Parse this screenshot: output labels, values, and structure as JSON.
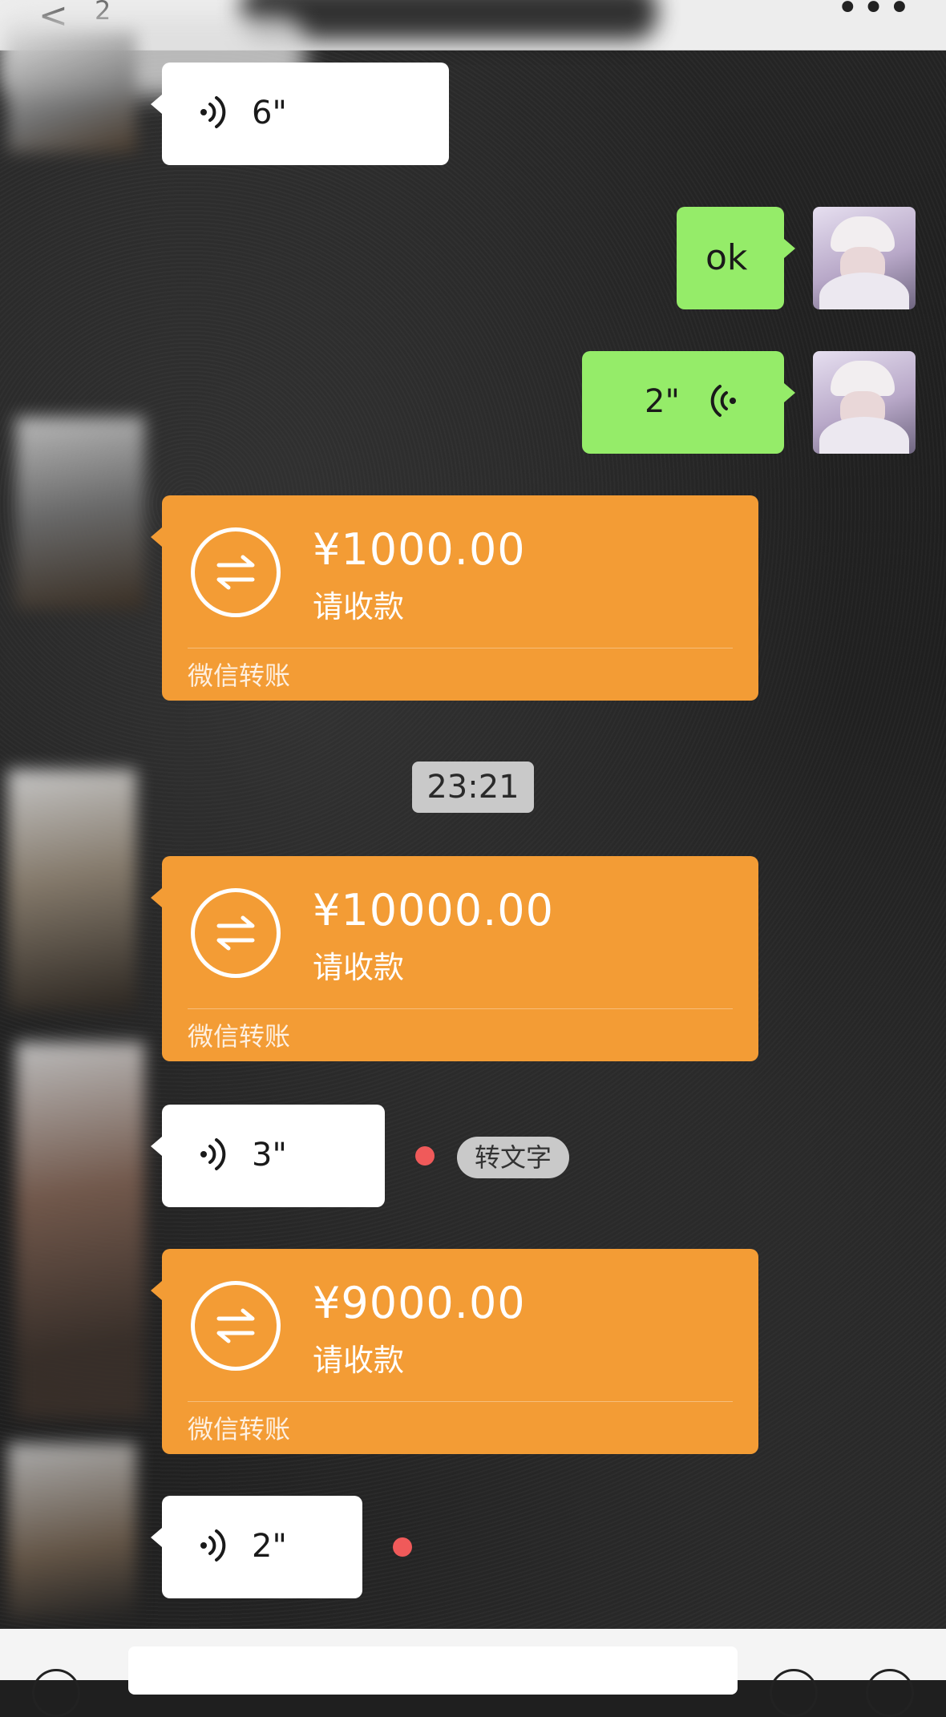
{
  "top_bar": {
    "back_glyph": "<",
    "unread_count": "2",
    "more_glyph": "•••"
  },
  "messages": {
    "voice_1": {
      "duration": "6\"",
      "unread": false
    },
    "text_ok": {
      "text": "ok"
    },
    "voice_sent": {
      "duration": "2\""
    },
    "transfer_1": {
      "amount": "¥1000.00",
      "status": "请收款",
      "footer": "微信转账"
    },
    "timestamp": "23:21",
    "transfer_2": {
      "amount": "¥10000.00",
      "status": "请收款",
      "footer": "微信转账"
    },
    "voice_2": {
      "duration": "3\"",
      "unread": true,
      "to_text_label": "转文字"
    },
    "transfer_3": {
      "amount": "¥9000.00",
      "status": "请收款",
      "footer": "微信转账"
    },
    "voice_3": {
      "duration": "2\"",
      "unread": true
    }
  },
  "colors": {
    "transfer_orange": "#f39c35",
    "sent_green": "#95ec69",
    "unread_dot": "#f05a5a",
    "bubble_white": "#ffffff"
  },
  "icons": [
    "back-icon",
    "more-icon",
    "voice-wave-icon",
    "transfer-arrows-icon",
    "voice-input-icon",
    "emoji-icon",
    "plus-icon"
  ]
}
